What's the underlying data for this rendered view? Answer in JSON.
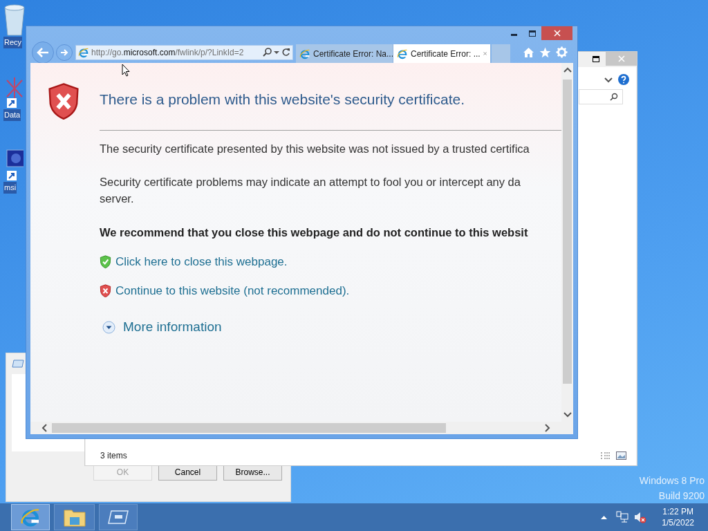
{
  "desktop": {
    "icons": [
      {
        "label": "Recy",
        "kind": "bin"
      },
      {
        "label": "Data",
        "kind": "app"
      },
      {
        "label": "msi",
        "kind": "monitor"
      }
    ],
    "watermark": [
      "Windows 8 Pro",
      "Build 9200"
    ]
  },
  "dialog": {
    "buttons": [
      {
        "label": "OK",
        "disabled": true
      },
      {
        "label": "Cancel",
        "disabled": false
      },
      {
        "label": "Browse...",
        "disabled": false
      }
    ]
  },
  "explorer": {
    "status": "3 items"
  },
  "browser": {
    "address": {
      "before": "http://go.",
      "domain": "microsoft.com",
      "after": "/fwlink/p/?LinkId=2"
    },
    "tabs": [
      {
        "title": "Certificate Error: Na...",
        "selected": false
      },
      {
        "title": "Certificate Error: ...",
        "selected": true
      }
    ],
    "page": {
      "heading": "There is a problem with this website's security certificate.",
      "paragraphs": [
        "The security certificate presented by this website was not issued by a trusted certifica",
        "Security certificate problems may indicate an attempt to fool you or intercept any da\nserver."
      ],
      "recommendation": "We recommend that you close this webpage and do not continue to this websit",
      "links": [
        {
          "text": "Click here to close this webpage.",
          "kind": "safe"
        },
        {
          "text": "Continue to this website (not recommended).",
          "kind": "danger"
        }
      ],
      "more": "More information"
    }
  },
  "taskbar": {
    "apps": [
      {
        "kind": "ie",
        "selected": true
      },
      {
        "kind": "explorer",
        "selected": false
      },
      {
        "kind": "window",
        "selected": false
      }
    ],
    "time": "1:22 PM",
    "date": "1/5/2022"
  }
}
